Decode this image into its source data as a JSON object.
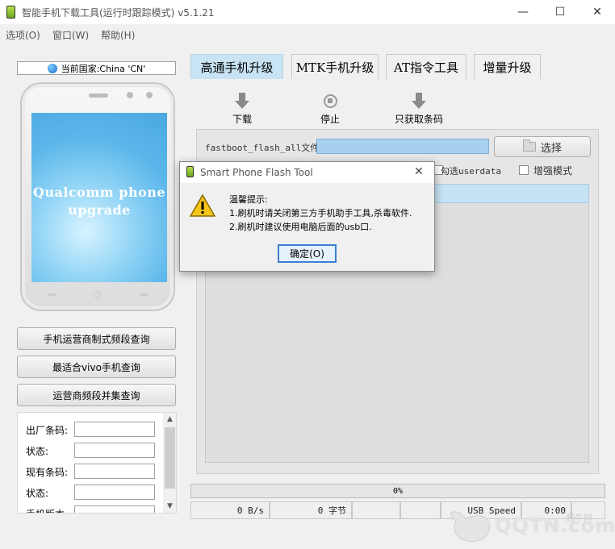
{
  "window": {
    "title": "智能手机下载工具(运行时跟踪模式)  v5.1.21",
    "minimize_glyph": "—",
    "maximize_glyph": "☐",
    "close_glyph": "✕"
  },
  "menu": {
    "items": [
      "选项(O)",
      "窗口(W)",
      "帮助(H)"
    ]
  },
  "left_panel": {
    "country": "当前国家:China 'CN'",
    "phone_screen_text": "Qualcomm phone upgrade",
    "buttons": [
      "手机运营商制式频段查询",
      "最适合vivo手机查询",
      "运营商频段并集查询"
    ],
    "info_labels": [
      "出厂条码:",
      "状态:",
      "现有条码:",
      "状态:",
      "手机版本"
    ],
    "scroll_up": "▲",
    "scroll_down": "▼"
  },
  "tabs": [
    "高通手机升级",
    "MTK手机升级",
    "AT指令工具",
    "增量升级"
  ],
  "toolbar": {
    "download": "下载",
    "stop": "停止",
    "barcode_only": "只获取条码"
  },
  "form": {
    "fastboot_label": "fastboot_flash_all文件",
    "select_label": "选择",
    "userdata_label": "勾选userdata",
    "enhanced_label": "增强模式"
  },
  "progress": {
    "percent": "0%"
  },
  "statusbar": {
    "speed_value": "0 B/s",
    "bytes_value": "0 字节",
    "speed_label": "USB Speed",
    "time": "0:00"
  },
  "dialog": {
    "title": "Smart Phone Flash Tool",
    "close_glyph": "✕",
    "heading": "温馨提示:",
    "line1": "1.刷机时请关闭第三方手机助手工具,杀毒软件.",
    "line2": "2.刷机时建议使用电脑后面的usb口.",
    "ok_label": "确定(O)"
  },
  "watermark": {
    "logo_text": "QQTN.com",
    "cn_text": "腾牛网"
  }
}
